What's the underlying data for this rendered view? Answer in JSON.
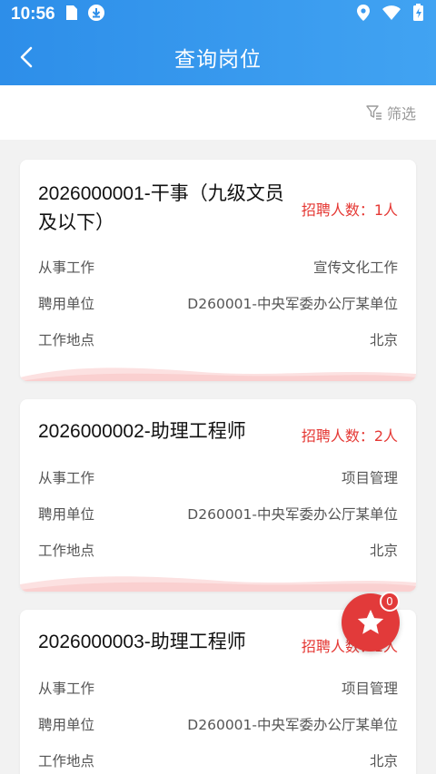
{
  "status_bar": {
    "time": "10:56",
    "icons_left": [
      "sim-card-icon",
      "download-icon"
    ],
    "icons_right": [
      "location-icon",
      "wifi-icon",
      "battery-charging-icon"
    ]
  },
  "header": {
    "title": "查询岗位",
    "back_icon": "chevron-left-icon",
    "background_colors": [
      "#2d8ee9",
      "#41a3f2"
    ]
  },
  "filter": {
    "label": "筛选",
    "icon": "filter-icon"
  },
  "row_labels": {
    "work": "从事工作",
    "unit": "聘用单位",
    "location": "工作地点"
  },
  "jobs": [
    {
      "title_line1": "2026000001-干事（九级文员",
      "title_line2": "及以下）",
      "count": "招聘人数：1人",
      "work": "宣传文化工作",
      "unit": "D260001-中央军委办公厅某单位",
      "location": "北京"
    },
    {
      "title_line1": "2026000002-助理工程师",
      "title_line2": "",
      "count": "招聘人数：2人",
      "work": "项目管理",
      "unit": "D260001-中央军委办公厅某单位",
      "location": "北京"
    },
    {
      "title_line1": "2026000003-助理工程师",
      "title_line2": "",
      "count": "招聘人数：1人",
      "work": "项目管理",
      "unit": "D260001-中央军委办公厅某单位",
      "location": "北京"
    }
  ],
  "favorites": {
    "icon": "star-icon",
    "badge": "0"
  },
  "colors": {
    "accent": "#2d8ee9",
    "count_red": "#e53935",
    "fab_red": "#e23a3a"
  }
}
